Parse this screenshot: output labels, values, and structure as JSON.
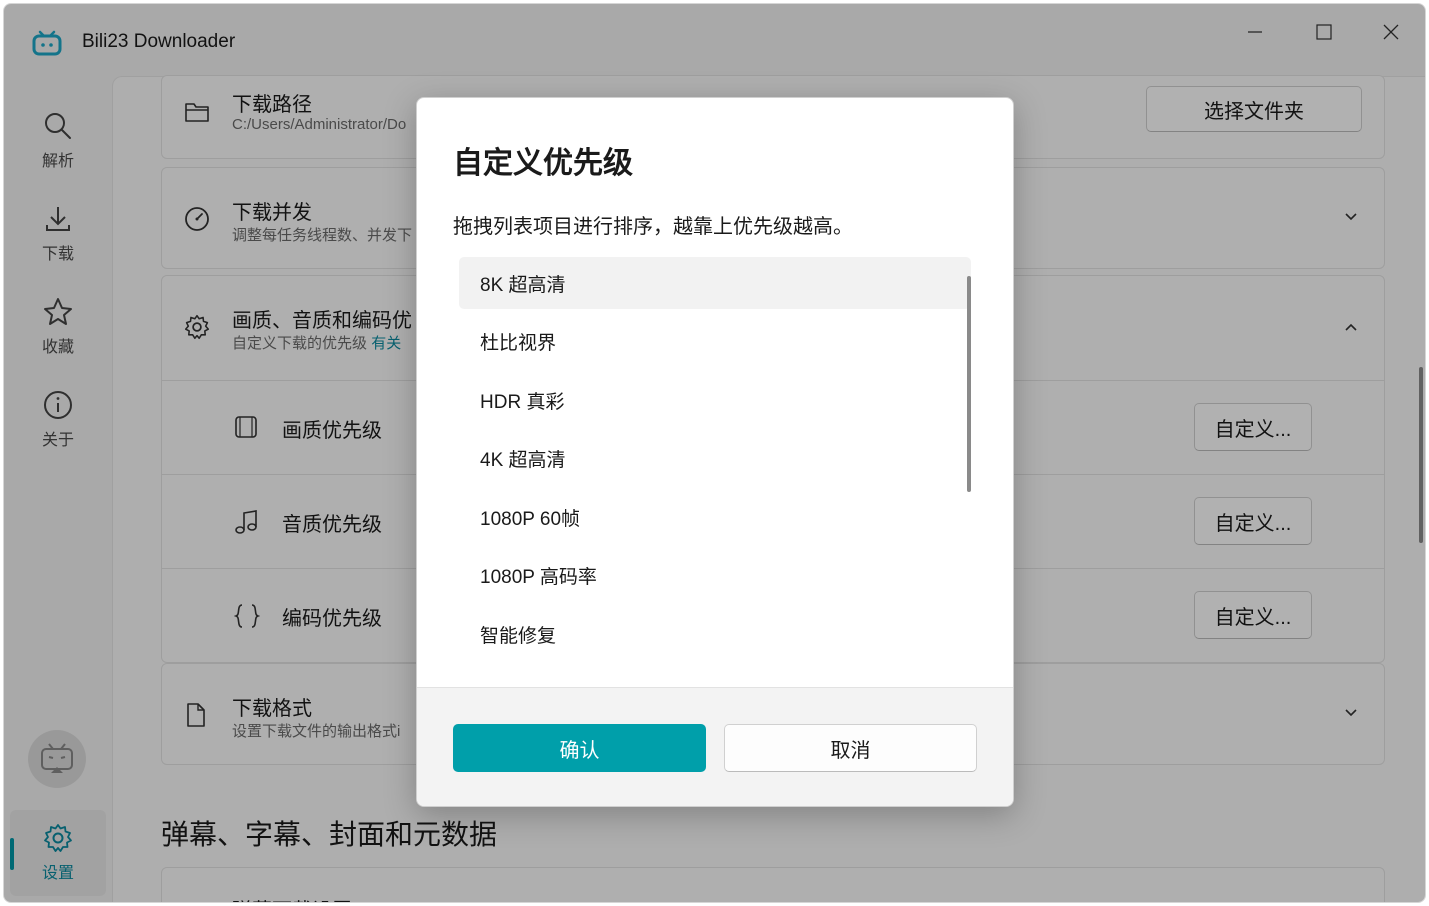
{
  "app": {
    "title": "Bili23 Downloader",
    "icon": "bilibili-tv-icon"
  },
  "window_controls": [
    "minimize-icon",
    "maximize-icon",
    "close-icon"
  ],
  "sidebar": {
    "items": [
      {
        "label": "解析",
        "icon": "search-icon"
      },
      {
        "label": "下载",
        "icon": "download-icon"
      },
      {
        "label": "收藏",
        "icon": "star-icon"
      },
      {
        "label": "关于",
        "icon": "info-icon"
      },
      {
        "label": "设置",
        "icon": "gear-icon",
        "selected": true
      }
    ]
  },
  "settings": {
    "download_path": {
      "title": "下载路径",
      "value": "C:/Users/Administrator/Do",
      "button": "选择文件夹"
    },
    "concurrency": {
      "title": "下载并发",
      "subtitle": "调整每任务线程数、并发下"
    },
    "quality": {
      "title": "画质、音质和编码优",
      "subtitle": "自定义下载的优先级",
      "link": "有关",
      "rows": [
        {
          "label": "画质优先级",
          "button": "自定义..."
        },
        {
          "label": "音质优先级",
          "button": "自定义..."
        },
        {
          "label": "编码优先级",
          "button": "自定义..."
        }
      ]
    },
    "format": {
      "title": "下载格式",
      "subtitle": "设置下载文件的输出格式i"
    },
    "section_heading": "弹幕、字幕、封面和元数据",
    "next_card_title": "弹幕下载设置"
  },
  "dialog": {
    "title": "自定义优先级",
    "description": "拖拽列表项目进行排序，越靠上优先级越高。",
    "items": [
      "8K 超高清",
      "杜比视界",
      "HDR 真彩",
      "4K 超高清",
      "1080P 60帧",
      "1080P 高码率",
      "智能修复"
    ],
    "confirm": "确认",
    "cancel": "取消"
  },
  "colors": {
    "accent": "#009faa",
    "overlay": "rgba(0,0,0,0.30)",
    "link": "#0b8aa0"
  }
}
